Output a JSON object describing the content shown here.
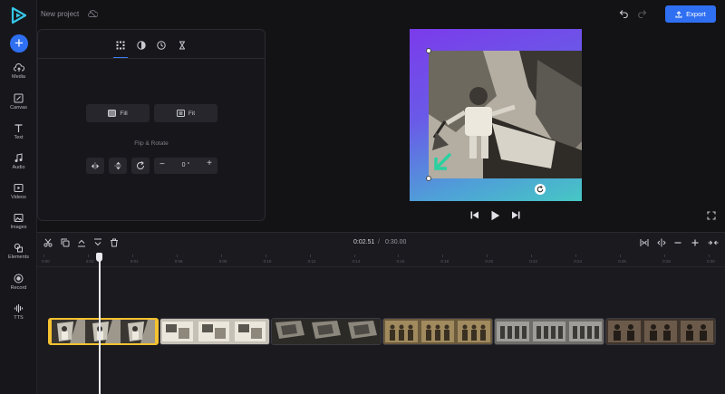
{
  "header": {
    "project_title": "New project",
    "export_label": "Export"
  },
  "sidebar": {
    "items": [
      {
        "label": "Media",
        "icon": "cloud-upload-icon"
      },
      {
        "label": "Canvas",
        "icon": "canvas-icon"
      },
      {
        "label": "Text",
        "icon": "text-icon"
      },
      {
        "label": "Audio",
        "icon": "music-note-icon"
      },
      {
        "label": "Videos",
        "icon": "video-icon"
      },
      {
        "label": "Images",
        "icon": "image-icon"
      },
      {
        "label": "Elements",
        "icon": "shapes-icon"
      },
      {
        "label": "Record",
        "icon": "record-icon"
      },
      {
        "label": "TTS",
        "icon": "waveform-icon"
      }
    ]
  },
  "panel": {
    "tabs": [
      "crop-tab-icon",
      "adjust-tab-icon",
      "speed-tab-icon",
      "timing-tab-icon"
    ],
    "fill_label": "Fill",
    "fit_label": "Fit",
    "flip_rotate_label": "Flip & Rotate",
    "rotation_value": "0 °",
    "minus_label": "−",
    "plus_label": "+"
  },
  "timeline": {
    "current_time": "0:02.51",
    "separator": "/",
    "total_time": "0:30.00",
    "ticks": [
      "0:00",
      "0:02",
      "0:04",
      "0:06",
      "0:08",
      "0:10",
      "0:12",
      "0:14",
      "0:16",
      "0:18",
      "0:20",
      "0:22",
      "0:24",
      "0:26",
      "0:28",
      "0:30"
    ],
    "playhead_position_s": 2.51
  },
  "colors": {
    "accent": "#2f6ff2",
    "selection": "#f5c230",
    "background": "#131316"
  }
}
